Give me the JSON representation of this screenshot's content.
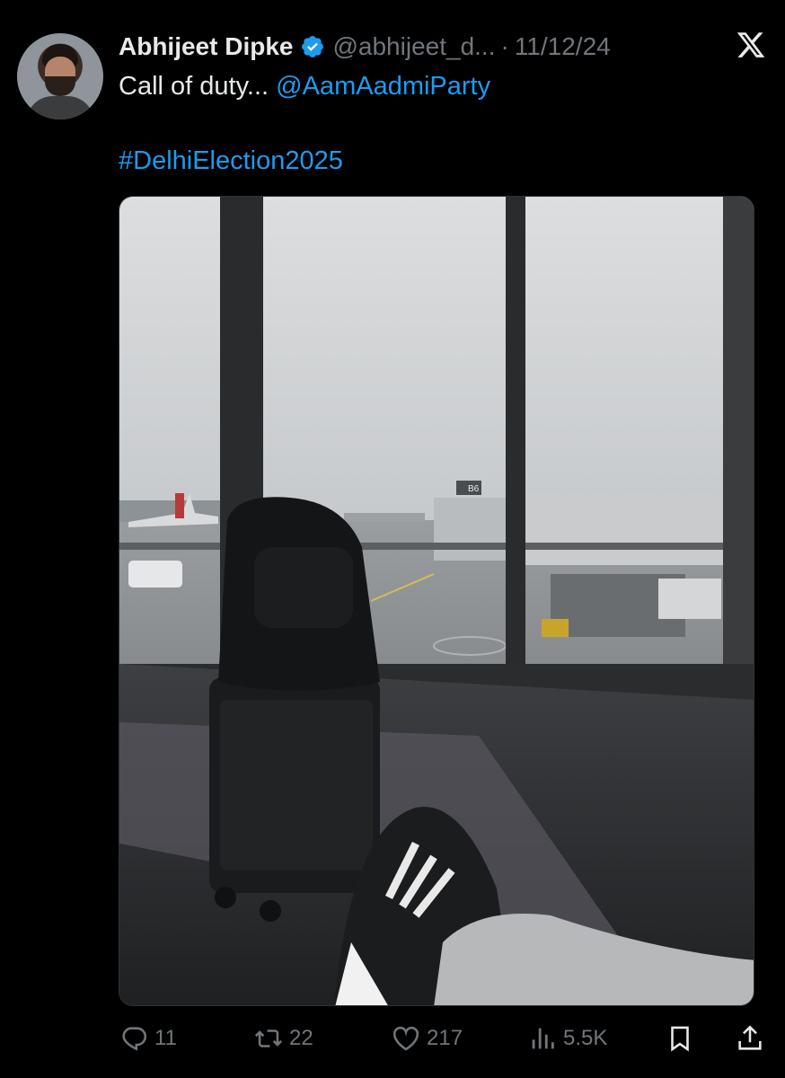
{
  "tweet": {
    "author_name": "Abhijeet Dipke",
    "handle": "@abhijeet_d...",
    "separator": "·",
    "date": "11/12/24",
    "text_line1": "Call of duty... ",
    "mention": "@AamAadmiParty",
    "hashtag": "#DelhiElection2025"
  },
  "media": {
    "alt": "Backpack on rolling suitcase by airport window on a rainy day, sneaker in foreground",
    "gate_sign": "B6"
  },
  "actions": {
    "replies": "11",
    "reposts": "22",
    "likes": "217",
    "views": "5.5K"
  },
  "colors": {
    "background": "#000000",
    "text": "#e7e9ea",
    "secondary": "#71767b",
    "link": "#1d9bf0",
    "verified": "#1d9bf0"
  },
  "icons": [
    "verified-badge-icon",
    "x-logo-icon",
    "reply-icon",
    "repost-icon",
    "like-icon",
    "views-icon",
    "bookmark-icon",
    "share-icon"
  ]
}
